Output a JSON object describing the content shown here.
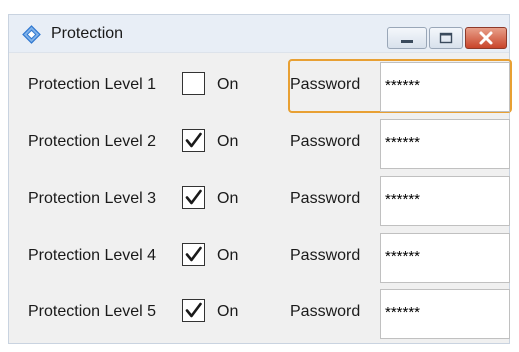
{
  "window": {
    "title": "Protection",
    "icon": "diamond-icon",
    "controls": [
      "minimize-icon",
      "maximize-icon",
      "close-icon"
    ],
    "close_color": "#c9452b",
    "focus_color": "#e8a033"
  },
  "rows": [
    {
      "level_label": "Protection Level 1",
      "checked": false,
      "on_label": "On",
      "password_label": "Password",
      "password_value": "******",
      "focused": true
    },
    {
      "level_label": "Protection Level 2",
      "checked": true,
      "on_label": "On",
      "password_label": "Password",
      "password_value": "******",
      "focused": false
    },
    {
      "level_label": "Protection Level 3",
      "checked": true,
      "on_label": "On",
      "password_label": "Password",
      "password_value": "******",
      "focused": false
    },
    {
      "level_label": "Protection Level 4",
      "checked": true,
      "on_label": "On",
      "password_label": "Password",
      "password_value": "******",
      "focused": false
    },
    {
      "level_label": "Protection Level 5",
      "checked": true,
      "on_label": "On",
      "password_label": "Password",
      "password_value": "******",
      "focused": false
    }
  ]
}
